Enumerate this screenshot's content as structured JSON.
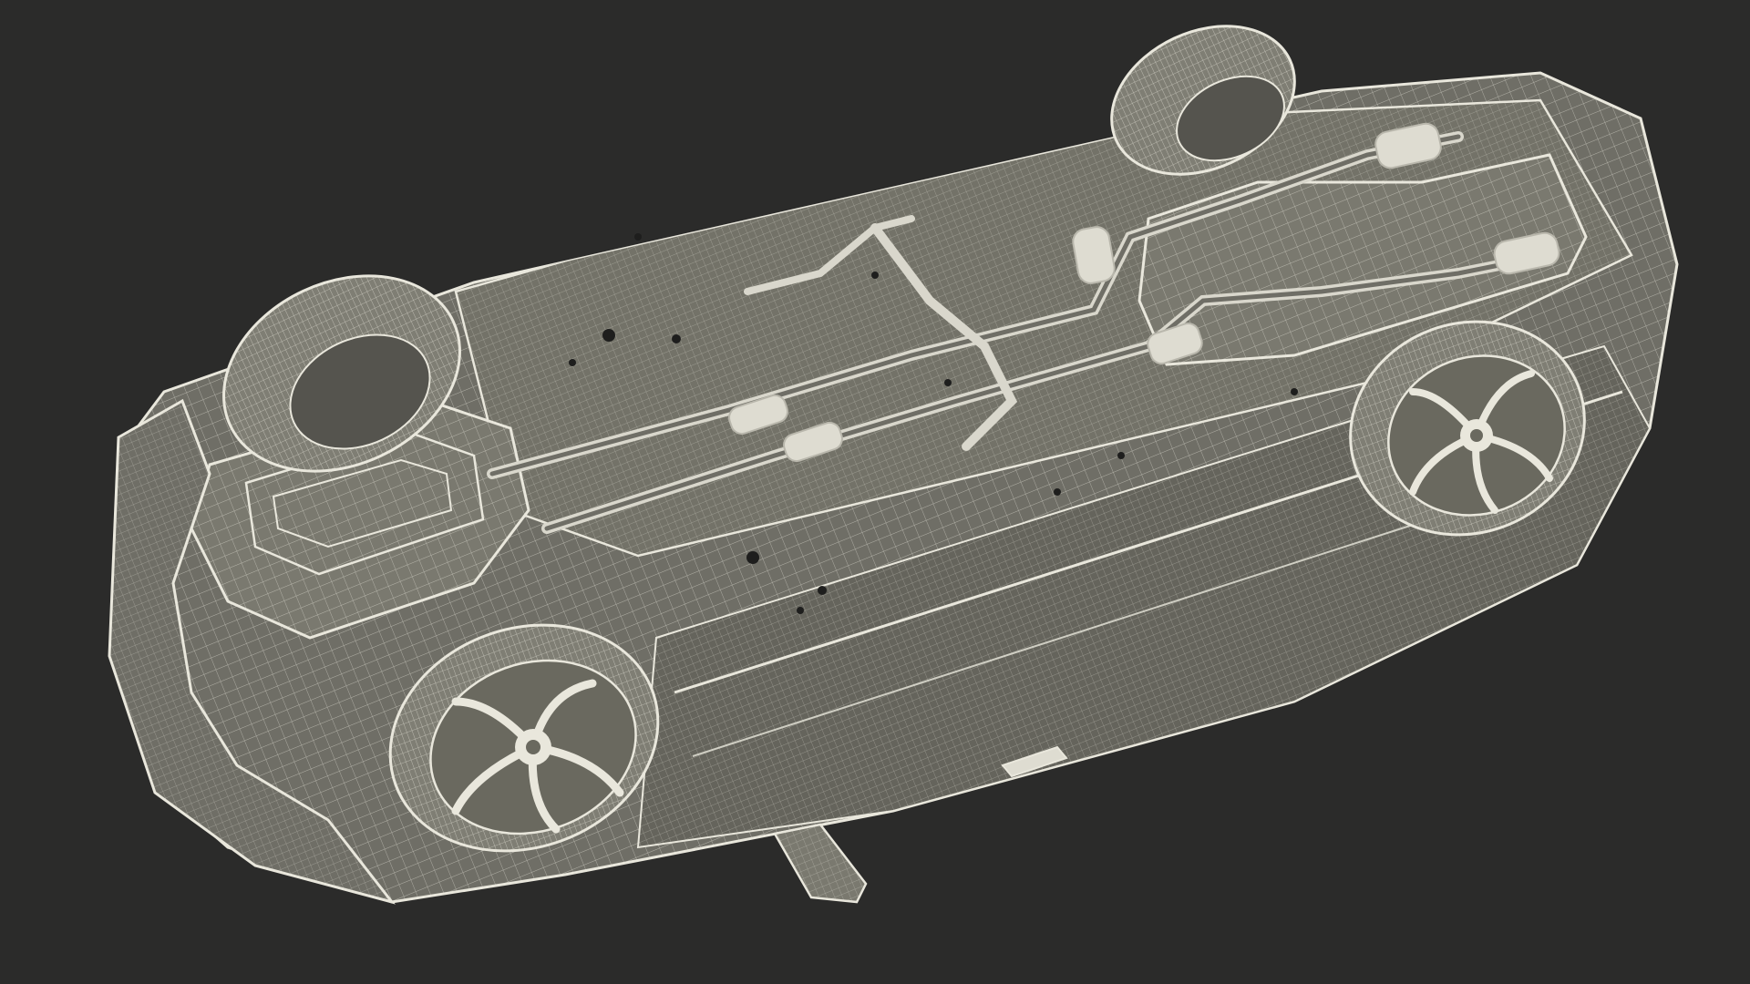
{
  "scene": {
    "subject": "car-underside-wireframe",
    "background_color": "#2b2b2a",
    "panel_color": "#6f6e66",
    "panel_dark_color": "#5f5e57",
    "wire_color": "#e9e7dc",
    "part_color": "#d9d7cc"
  }
}
